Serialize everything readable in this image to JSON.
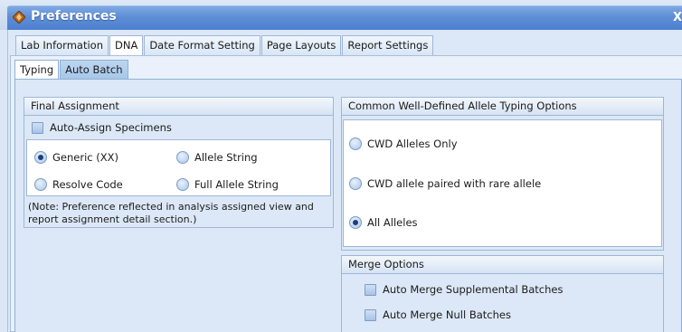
{
  "window": {
    "title": "Preferences",
    "close_label": "X"
  },
  "tabs": [
    {
      "label": "Lab Information",
      "active": false
    },
    {
      "label": "DNA",
      "active": true
    },
    {
      "label": "Date Format Setting",
      "active": false
    },
    {
      "label": "Page Layouts",
      "active": false
    },
    {
      "label": "Report Settings",
      "active": false
    }
  ],
  "subtabs": [
    {
      "label": "Typing",
      "active": true
    },
    {
      "label": "Auto Batch",
      "active": false
    }
  ],
  "final_assignment": {
    "header": "Final Assignment",
    "auto_assign_label": "Auto-Assign Specimens",
    "auto_assign_checked": false,
    "options": [
      {
        "label": "Generic (XX)",
        "checked": true
      },
      {
        "label": "Allele String",
        "checked": false
      },
      {
        "label": "Resolve Code",
        "checked": false
      },
      {
        "label": "Full Allele String",
        "checked": false
      }
    ],
    "note_line1": "(Note: Preference reflected in analysis assigned view and",
    "note_line2": "report assignment detail section.)"
  },
  "cwd": {
    "header": "Common Well-Defined Allele Typing Options",
    "options": [
      {
        "label": "CWD Alleles Only",
        "checked": false
      },
      {
        "label": "CWD allele paired with rare allele",
        "checked": false
      },
      {
        "label": "All Alleles",
        "checked": true
      }
    ]
  },
  "merge": {
    "header": "Merge Options",
    "options": [
      {
        "label": "Auto Merge Supplemental Batches",
        "checked": false
      },
      {
        "label": "Auto Merge Null Batches",
        "checked": false
      }
    ]
  },
  "colors": {
    "title_bar": "#5e8ed6",
    "panel_bg": "#dce8f7",
    "border": "#9fb7d6"
  }
}
